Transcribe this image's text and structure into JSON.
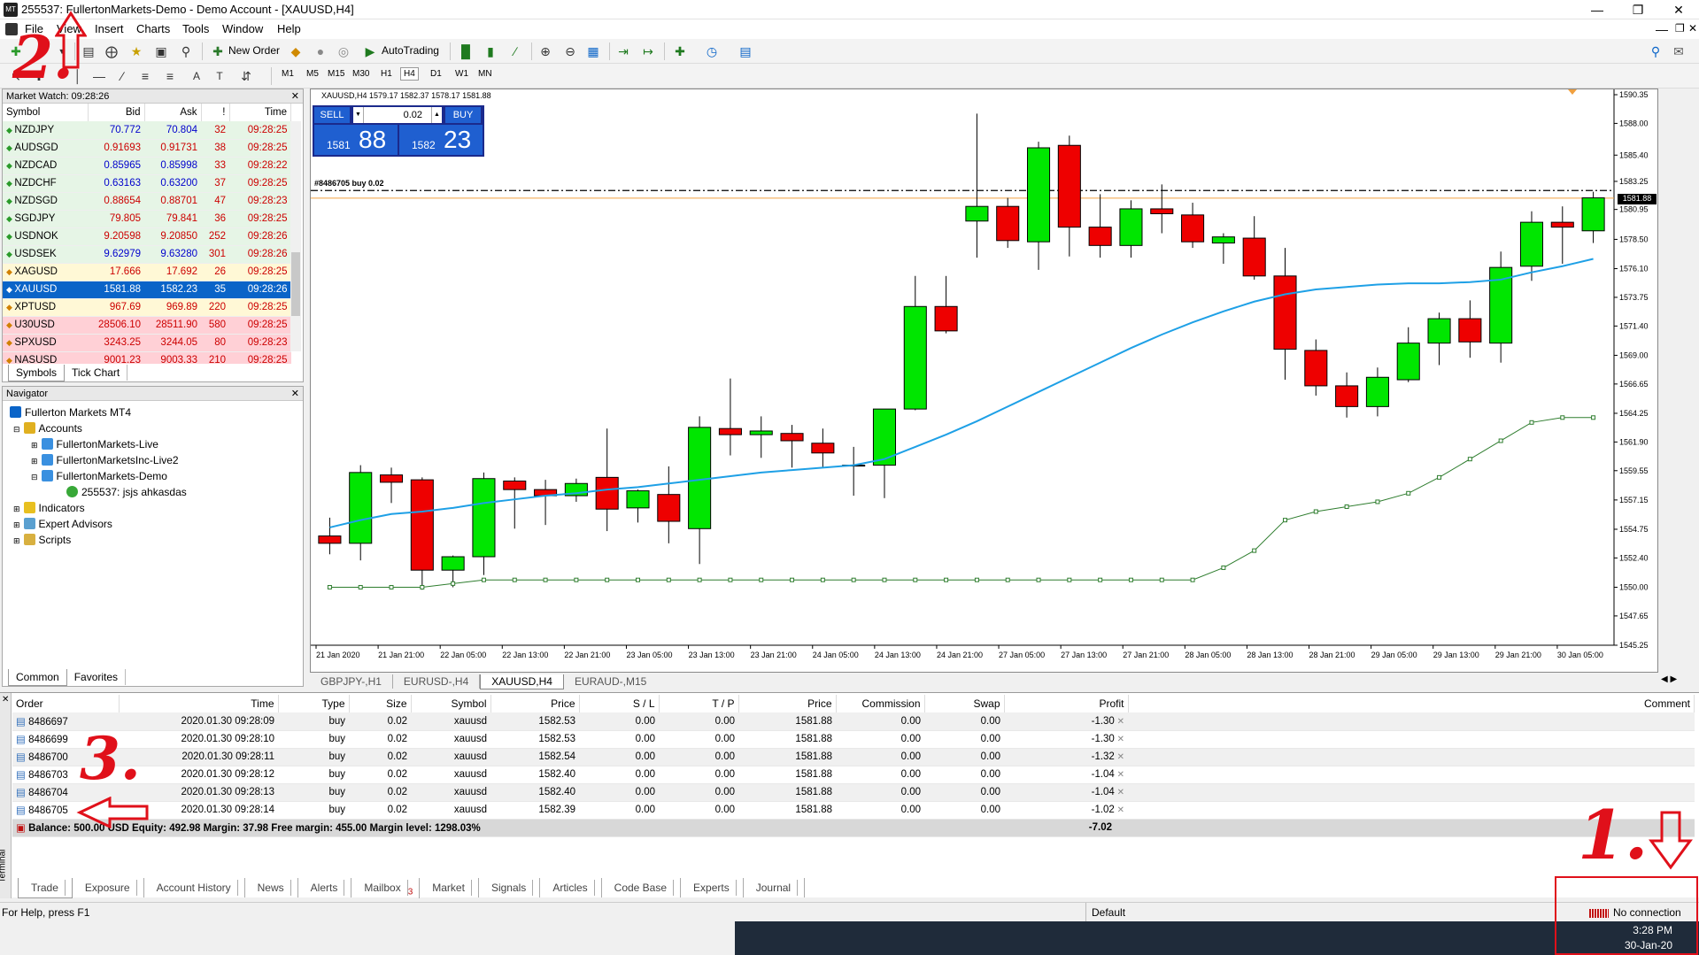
{
  "window": {
    "title": "255537: FullertonMarkets-Demo - Demo Account - [XAUUSD,H4]",
    "app_icon": "metatrader-icon"
  },
  "menu": [
    "File",
    "View",
    "Insert",
    "Charts",
    "Tools",
    "Window",
    "Help"
  ],
  "toolbar": {
    "new_order": "New Order",
    "autotrading": "AutoTrading",
    "timeframes": [
      "M1",
      "M5",
      "M15",
      "M30",
      "H1",
      "H4",
      "D1",
      "W1",
      "MN"
    ],
    "active_timeframe": "H4"
  },
  "market_watch": {
    "title": "Market Watch: 09:28:26",
    "columns": [
      "Symbol",
      "Bid",
      "Ask",
      "!",
      "Time"
    ],
    "rows": [
      {
        "symbol": "NZDJPY",
        "bid": "70.772",
        "ask": "70.804",
        "spread": "32",
        "time": "09:28:25",
        "bg": "#e6f5e6",
        "color": "blue"
      },
      {
        "symbol": "AUDSGD",
        "bid": "0.91693",
        "ask": "0.91731",
        "spread": "38",
        "time": "09:28:25",
        "bg": "#e6f5e6",
        "color": "red"
      },
      {
        "symbol": "NZDCAD",
        "bid": "0.85965",
        "ask": "0.85998",
        "spread": "33",
        "time": "09:28:22",
        "bg": "#e6f5e6",
        "color": "blue"
      },
      {
        "symbol": "NZDCHF",
        "bid": "0.63163",
        "ask": "0.63200",
        "spread": "37",
        "time": "09:28:25",
        "bg": "#e6f5e6",
        "color": "blue"
      },
      {
        "symbol": "NZDSGD",
        "bid": "0.88654",
        "ask": "0.88701",
        "spread": "47",
        "time": "09:28:23",
        "bg": "#e6f5e6",
        "color": "red"
      },
      {
        "symbol": "SGDJPY",
        "bid": "79.805",
        "ask": "79.841",
        "spread": "36",
        "time": "09:28:25",
        "bg": "#e6f5e6",
        "color": "red"
      },
      {
        "symbol": "USDNOK",
        "bid": "9.20598",
        "ask": "9.20850",
        "spread": "252",
        "time": "09:28:26",
        "bg": "#e6f5e6",
        "color": "red"
      },
      {
        "symbol": "USDSEK",
        "bid": "9.62979",
        "ask": "9.63280",
        "spread": "301",
        "time": "09:28:26",
        "bg": "#e6f5e6",
        "color": "blue"
      },
      {
        "symbol": "XAGUSD",
        "bid": "17.666",
        "ask": "17.692",
        "spread": "26",
        "time": "09:28:25",
        "bg": "#fff8d6",
        "color": "red"
      },
      {
        "symbol": "XAUUSD",
        "bid": "1581.88",
        "ask": "1582.23",
        "spread": "35",
        "time": "09:28:26",
        "bg": "#0a64c8",
        "color": "white"
      },
      {
        "symbol": "XPTUSD",
        "bid": "967.69",
        "ask": "969.89",
        "spread": "220",
        "time": "09:28:25",
        "bg": "#fff8d6",
        "color": "red"
      },
      {
        "symbol": "U30USD",
        "bid": "28506.10",
        "ask": "28511.90",
        "spread": "580",
        "time": "09:28:25",
        "bg": "#ffd0d6",
        "color": "red"
      },
      {
        "symbol": "SPXUSD",
        "bid": "3243.25",
        "ask": "3244.05",
        "spread": "80",
        "time": "09:28:23",
        "bg": "#ffd0d6",
        "color": "red"
      },
      {
        "symbol": "NASUSD",
        "bid": "9001.23",
        "ask": "9003.33",
        "spread": "210",
        "time": "09:28:25",
        "bg": "#ffd0d6",
        "color": "red"
      }
    ],
    "tabs": [
      "Symbols",
      "Tick Chart"
    ]
  },
  "navigator": {
    "title": "Navigator",
    "root": "Fullerton Markets MT4",
    "accounts": "Accounts",
    "servers": [
      "FullertonMarkets-Live",
      "FullertonMarketsInc-Live2",
      "FullertonMarkets-Demo"
    ],
    "account": "255537: jsjs ahkasdas",
    "items": [
      "Indicators",
      "Expert Advisors",
      "Scripts"
    ],
    "tabs": [
      "Common",
      "Favorites"
    ]
  },
  "chart": {
    "header": "XAUUSD,H4  1579.17 1582.37 1578.17 1581.88",
    "sell_label": "SELL",
    "buy_label": "BUY",
    "lot": "0.02",
    "sell_small": "1581",
    "sell_big": "88",
    "buy_small": "1582",
    "buy_big": "23",
    "order_line_label": "#8486705 buy 0.02",
    "current_price": "1581.88",
    "tabs": [
      "GBPJPY-,H1",
      "EURUSD-,H4",
      "XAUUSD,H4",
      "EURAUD-,M15"
    ],
    "active_tab": "XAUUSD,H4"
  },
  "chart_data": {
    "type": "candlestick",
    "title": "XAUUSD,H4",
    "y_ticks": [
      "1590.35",
      "1588.00",
      "1585.40",
      "1583.25",
      "1580.95",
      "1578.50",
      "1576.10",
      "1573.75",
      "1571.40",
      "1569.00",
      "1566.65",
      "1564.25",
      "1561.90",
      "1559.55",
      "1557.15",
      "1554.75",
      "1552.40",
      "1550.00",
      "1547.65",
      "1545.25"
    ],
    "x_ticks": [
      "21 Jan 2020",
      "21 Jan 21:00",
      "22 Jan 05:00",
      "22 Jan 13:00",
      "22 Jan 21:00",
      "23 Jan 05:00",
      "23 Jan 13:00",
      "23 Jan 21:00",
      "24 Jan 05:00",
      "24 Jan 13:00",
      "24 Jan 21:00",
      "27 Jan 05:00",
      "27 Jan 13:00",
      "27 Jan 21:00",
      "28 Jan 05:00",
      "28 Jan 13:00",
      "28 Jan 21:00",
      "29 Jan 05:00",
      "29 Jan 13:00",
      "29 Jan 21:00",
      "30 Jan 05:00"
    ],
    "ylim": [
      1545.25,
      1590.35
    ],
    "candles": [
      [
        1554.2,
        1555.7,
        1552.7,
        1553.6
      ],
      [
        1553.6,
        1560.0,
        1552.2,
        1559.4
      ],
      [
        1559.2,
        1559.8,
        1556.9,
        1558.6
      ],
      [
        1558.8,
        1559.0,
        1549.8,
        1551.4
      ],
      [
        1551.4,
        1552.6,
        1550.0,
        1552.5
      ],
      [
        1552.5,
        1559.4,
        1551.0,
        1558.9
      ],
      [
        1558.7,
        1559.0,
        1554.8,
        1558.0
      ],
      [
        1558.0,
        1558.8,
        1555.1,
        1557.5
      ],
      [
        1557.5,
        1558.9,
        1557.0,
        1558.5
      ],
      [
        1559.0,
        1563.0,
        1554.6,
        1556.4
      ],
      [
        1556.5,
        1558.0,
        1555.3,
        1557.9
      ],
      [
        1557.6,
        1559.9,
        1553.6,
        1555.4
      ],
      [
        1554.8,
        1564.0,
        1551.9,
        1563.1
      ],
      [
        1563.0,
        1567.1,
        1560.8,
        1562.5
      ],
      [
        1562.5,
        1564.0,
        1560.6,
        1562.8
      ],
      [
        1562.6,
        1563.3,
        1559.8,
        1562.0
      ],
      [
        1561.8,
        1563.0,
        1559.8,
        1561.0
      ],
      [
        1560.0,
        1561.5,
        1557.5,
        1560.0
      ],
      [
        1560.0,
        1564.6,
        1557.3,
        1564.6
      ],
      [
        1564.6,
        1575.5,
        1564.5,
        1573.0
      ],
      [
        1573.0,
        1575.5,
        1570.8,
        1571.0
      ],
      [
        1580.0,
        1588.8,
        1577.0,
        1581.2
      ],
      [
        1581.2,
        1581.9,
        1577.8,
        1578.4
      ],
      [
        1578.3,
        1586.5,
        1576.0,
        1586.0
      ],
      [
        1586.2,
        1587.0,
        1577.1,
        1579.5
      ],
      [
        1579.5,
        1582.2,
        1577.0,
        1578.0
      ],
      [
        1578.0,
        1581.7,
        1577.0,
        1581.0
      ],
      [
        1581.0,
        1583.0,
        1579.0,
        1580.6
      ],
      [
        1580.5,
        1581.5,
        1577.8,
        1578.3
      ],
      [
        1578.2,
        1579.0,
        1576.5,
        1578.7
      ],
      [
        1578.6,
        1580.4,
        1575.2,
        1575.5
      ],
      [
        1575.5,
        1577.8,
        1567.0,
        1569.5
      ],
      [
        1569.4,
        1570.3,
        1565.7,
        1566.5
      ],
      [
        1566.5,
        1567.6,
        1563.9,
        1564.8
      ],
      [
        1564.8,
        1568.0,
        1564.0,
        1567.2
      ],
      [
        1567.0,
        1571.3,
        1566.8,
        1570.0
      ],
      [
        1570.0,
        1572.5,
        1568.2,
        1572.0
      ],
      [
        1572.0,
        1573.5,
        1568.8,
        1570.1
      ],
      [
        1570.0,
        1577.5,
        1568.4,
        1576.2
      ],
      [
        1576.3,
        1580.8,
        1575.1,
        1579.9
      ],
      [
        1579.9,
        1581.2,
        1576.5,
        1579.5
      ],
      [
        1579.2,
        1582.4,
        1578.2,
        1581.9
      ]
    ],
    "ma_color": "#1ea0e6",
    "ma": [
      1554.9,
      1555.5,
      1556.0,
      1556.2,
      1556.5,
      1556.9,
      1557.2,
      1557.5,
      1557.7,
      1558.0,
      1558.2,
      1558.5,
      1558.8,
      1559.1,
      1559.4,
      1559.6,
      1559.8,
      1560.0,
      1560.5,
      1561.5,
      1562.5,
      1563.6,
      1564.8,
      1566.0,
      1567.2,
      1568.4,
      1569.6,
      1570.7,
      1571.7,
      1572.6,
      1573.4,
      1574.0,
      1574.4,
      1574.6,
      1574.8,
      1574.9,
      1574.9,
      1575.0,
      1575.2,
      1575.8,
      1576.3,
      1576.9
    ],
    "sar_color": "#2e7d2e",
    "sar": [
      1550.0,
      1550.0,
      1550.0,
      1550.0,
      1550.3,
      1550.6,
      1550.6,
      1550.6,
      1550.6,
      1550.6,
      1550.6,
      1550.6,
      1550.6,
      1550.6,
      1550.6,
      1550.6,
      1550.6,
      1550.6,
      1550.6,
      1550.6,
      1550.6,
      1550.6,
      1550.6,
      1550.6,
      1550.6,
      1550.6,
      1550.6,
      1550.6,
      1550.6,
      1551.6,
      1553.0,
      1555.5,
      1556.2,
      1556.6,
      1557.0,
      1557.7,
      1559.0,
      1560.5,
      1562.0,
      1563.5,
      1563.9,
      1563.9
    ]
  },
  "terminal": {
    "columns": [
      "Order",
      "Time",
      "Type",
      "Size",
      "Symbol",
      "Price",
      "S / L",
      "T / P",
      "Price",
      "Commission",
      "Swap",
      "Profit",
      "Comment"
    ],
    "rows": [
      [
        "8486697",
        "2020.01.30 09:28:09",
        "buy",
        "0.02",
        "xauusd",
        "1582.53",
        "0.00",
        "0.00",
        "1581.88",
        "0.00",
        "0.00",
        "-1.30"
      ],
      [
        "8486699",
        "2020.01.30 09:28:10",
        "buy",
        "0.02",
        "xauusd",
        "1582.53",
        "0.00",
        "0.00",
        "1581.88",
        "0.00",
        "0.00",
        "-1.30"
      ],
      [
        "8486700",
        "2020.01.30 09:28:11",
        "buy",
        "0.02",
        "xauusd",
        "1582.54",
        "0.00",
        "0.00",
        "1581.88",
        "0.00",
        "0.00",
        "-1.32"
      ],
      [
        "8486703",
        "2020.01.30 09:28:12",
        "buy",
        "0.02",
        "xauusd",
        "1582.40",
        "0.00",
        "0.00",
        "1581.88",
        "0.00",
        "0.00",
        "-1.04"
      ],
      [
        "8486704",
        "2020.01.30 09:28:13",
        "buy",
        "0.02",
        "xauusd",
        "1582.40",
        "0.00",
        "0.00",
        "1581.88",
        "0.00",
        "0.00",
        "-1.04"
      ],
      [
        "8486705",
        "2020.01.30 09:28:14",
        "buy",
        "0.02",
        "xauusd",
        "1582.39",
        "0.00",
        "0.00",
        "1581.88",
        "0.00",
        "0.00",
        "-1.02"
      ]
    ],
    "balance": "Balance: 500.00 USD  Equity: 492.98  Margin: 37.98  Free margin: 455.00  Margin level: 1298.03%",
    "total_profit": "-7.02",
    "tabs": [
      "Trade",
      "Exposure",
      "Account History",
      "News",
      "Alerts",
      "Mailbox",
      "Market",
      "Signals",
      "Articles",
      "Code Base",
      "Experts",
      "Journal"
    ],
    "mailbox_count": "3",
    "side_label": "Terminal"
  },
  "status": {
    "help": "For Help, press F1",
    "profile": "Default",
    "connection": "No connection"
  },
  "taskbar": {
    "time": "3:28 PM",
    "date": "30-Jan-20"
  },
  "annotations": {
    "one": "1.",
    "two": "2.",
    "three": "3."
  }
}
